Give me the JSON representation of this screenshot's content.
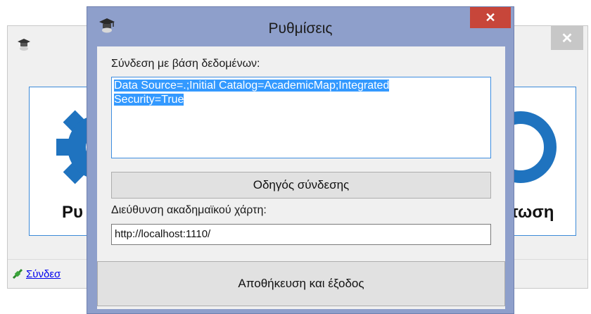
{
  "background_window": {
    "close_glyph": "✕",
    "left_tile_label": "Ρυ",
    "right_tile_label": "τωση",
    "status_link": "Σύνδεσ",
    "app_icon": "graduation-cap-icon",
    "status_icon": "plug-icon",
    "left_tile_icon": "gear-icon",
    "right_tile_icon": "ring-icon"
  },
  "dialog": {
    "title": "Ρυθμίσεις",
    "close_glyph": "✕",
    "app_icon": "graduation-cap-icon",
    "connection_label": "Σύνδεση με βάση δεδομένων:",
    "connection_line1": "Data Source=.;Initial Catalog=AcademicMap;Integrated",
    "connection_line2": "Security=True",
    "wizard_button": "Οδηγός σύνδεσης",
    "map_address_label": "Διεύθυνση ακαδημαϊκού χάρτη:",
    "map_address_value": "http://localhost:1110/",
    "save_exit_button": "Αποθήκευση και έξοδος"
  },
  "colors": {
    "dialog_frame": "#8e9fcb",
    "close_button": "#c7463a",
    "selection": "#3399ff",
    "focus_border": "#3d8de0",
    "tile_icon_blue": "#1f73bf"
  }
}
